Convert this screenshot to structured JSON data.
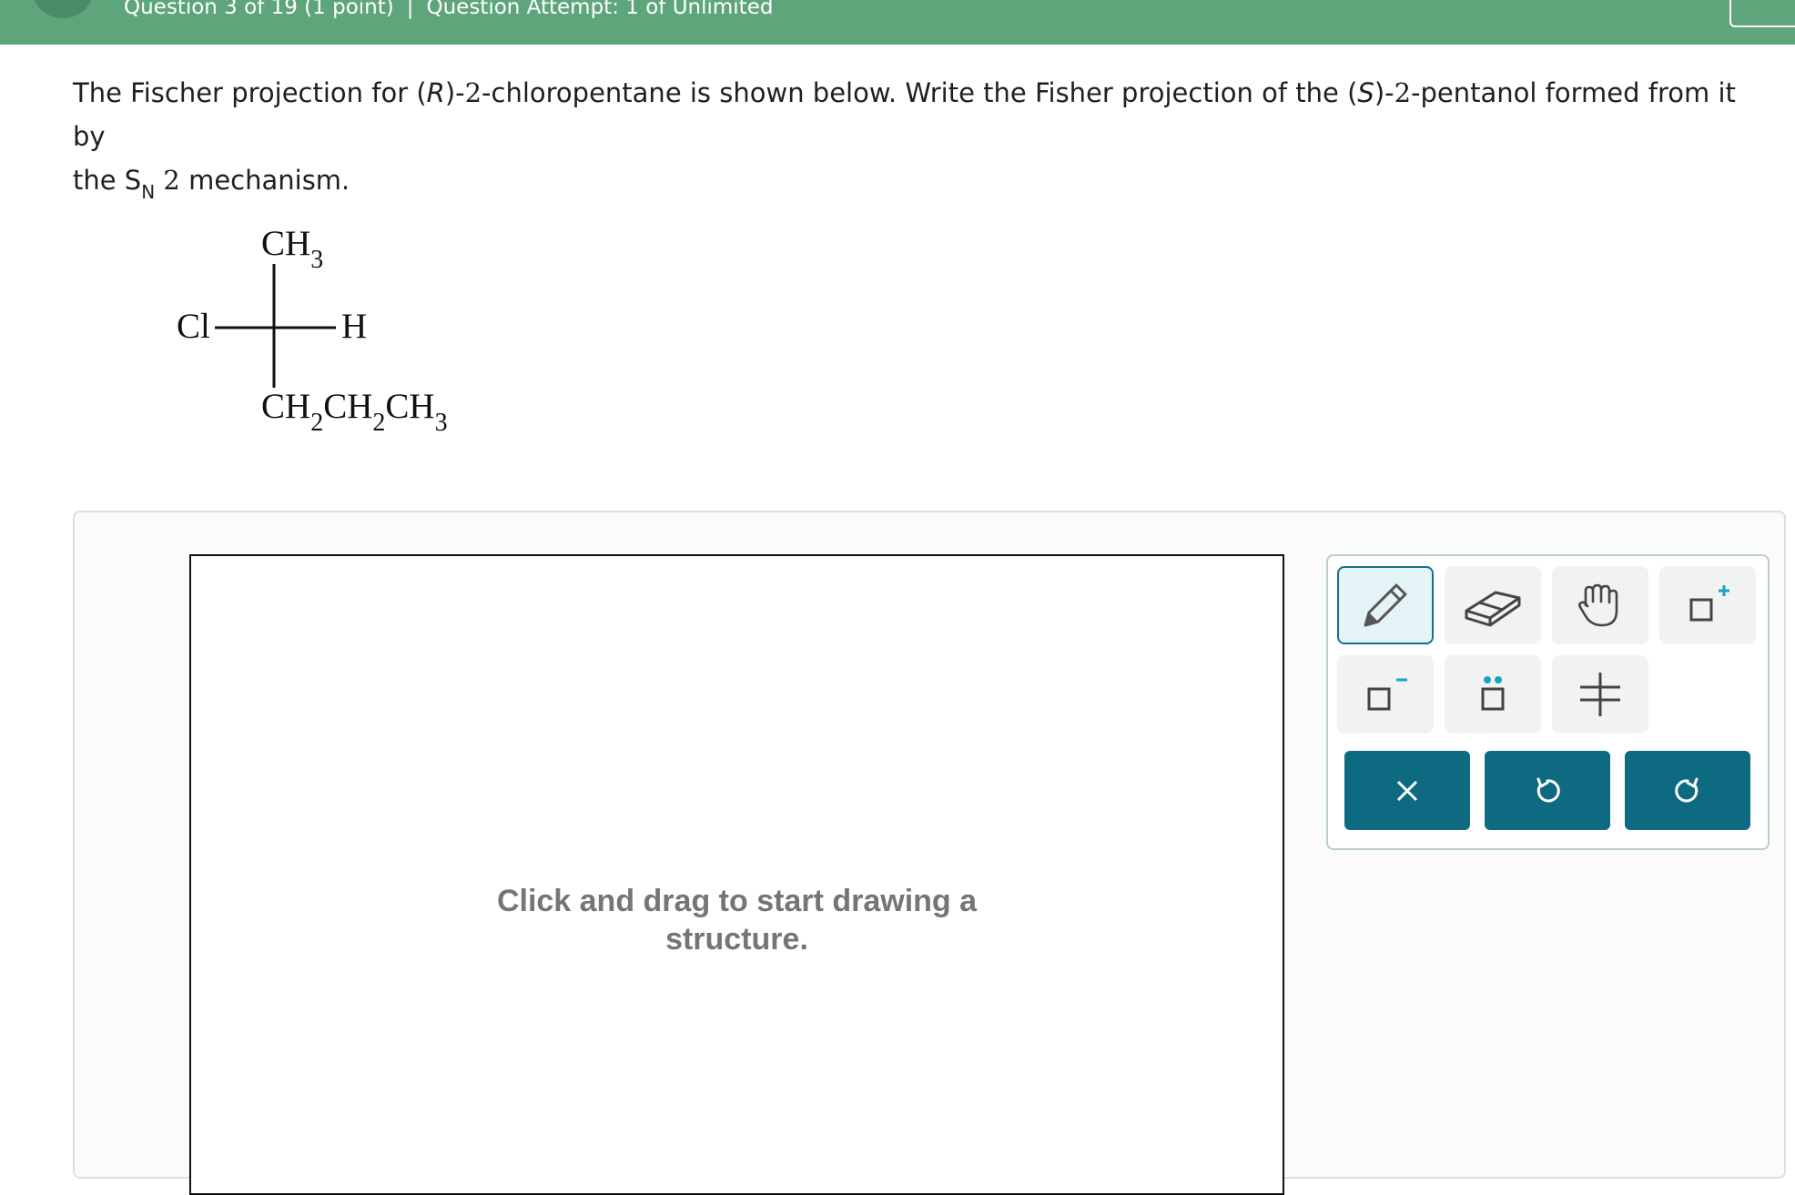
{
  "header": {
    "question_label": "Question 3 of 19 (1 point)",
    "separator": "|",
    "attempt_label": "Question Attempt: 1 of Unlimited"
  },
  "question": {
    "part1": "The Fischer projection for (",
    "r_label": "R",
    "part2": ")-",
    "num1": "2",
    "part3": "-chloropentane is shown below. Write the Fisher projection of the (",
    "s_label": "S",
    "part4": ")-",
    "num2": "2",
    "part5": "-pentanol formed from it by",
    "line2_start": "the S",
    "sub_n": "N",
    "num3": " 2",
    "line2_end": " mechanism."
  },
  "fischer": {
    "top": "CH",
    "top_sub": "3",
    "left": "Cl",
    "right": "H",
    "bottom_parts": [
      {
        "text": "CH",
        "sub": "2"
      },
      {
        "text": "CH",
        "sub": "2"
      },
      {
        "text": "CH",
        "sub": "3"
      }
    ]
  },
  "canvas": {
    "hint_line1": "Click and drag to start drawing a",
    "hint_line2": "structure."
  },
  "toolbar": {
    "tools": [
      "pencil-icon",
      "eraser-icon",
      "hand-icon",
      "add-charge-icon",
      "remove-charge-icon",
      "lone-pair-icon",
      "fischer-cross-icon"
    ],
    "actions": [
      "clear-icon",
      "undo-icon",
      "redo-icon"
    ],
    "colors": {
      "accent": "#13708a",
      "action_bg": "#0e6a80",
      "header_bg": "#5ea57c"
    }
  }
}
